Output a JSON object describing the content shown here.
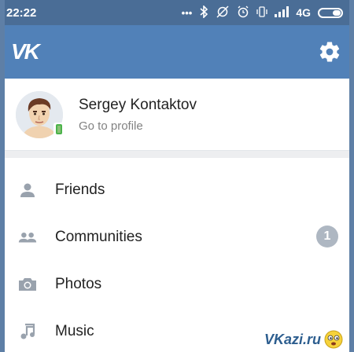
{
  "statusbar": {
    "time": "22:22",
    "network": "4G",
    "icons": [
      "more-dots-icon",
      "bluetooth-icon",
      "no-sync-icon",
      "alarm-icon",
      "vibrate-icon",
      "signal-icon",
      "battery-icon"
    ]
  },
  "toolbar": {
    "logo": "VK",
    "settings_icon": "gear-icon",
    "bg_color": "#5181b8"
  },
  "profile": {
    "name": "Sergey Kontaktov",
    "subtitle": "Go to profile"
  },
  "menu": {
    "items": [
      {
        "label": "Friends",
        "icon": "person-icon"
      },
      {
        "label": "Communities",
        "icon": "people-icon",
        "badge": "1"
      },
      {
        "label": "Photos",
        "icon": "camera-icon"
      },
      {
        "label": "Music",
        "icon": "music-note-icon"
      }
    ]
  },
  "watermark": {
    "text": "VKazi.ru"
  }
}
